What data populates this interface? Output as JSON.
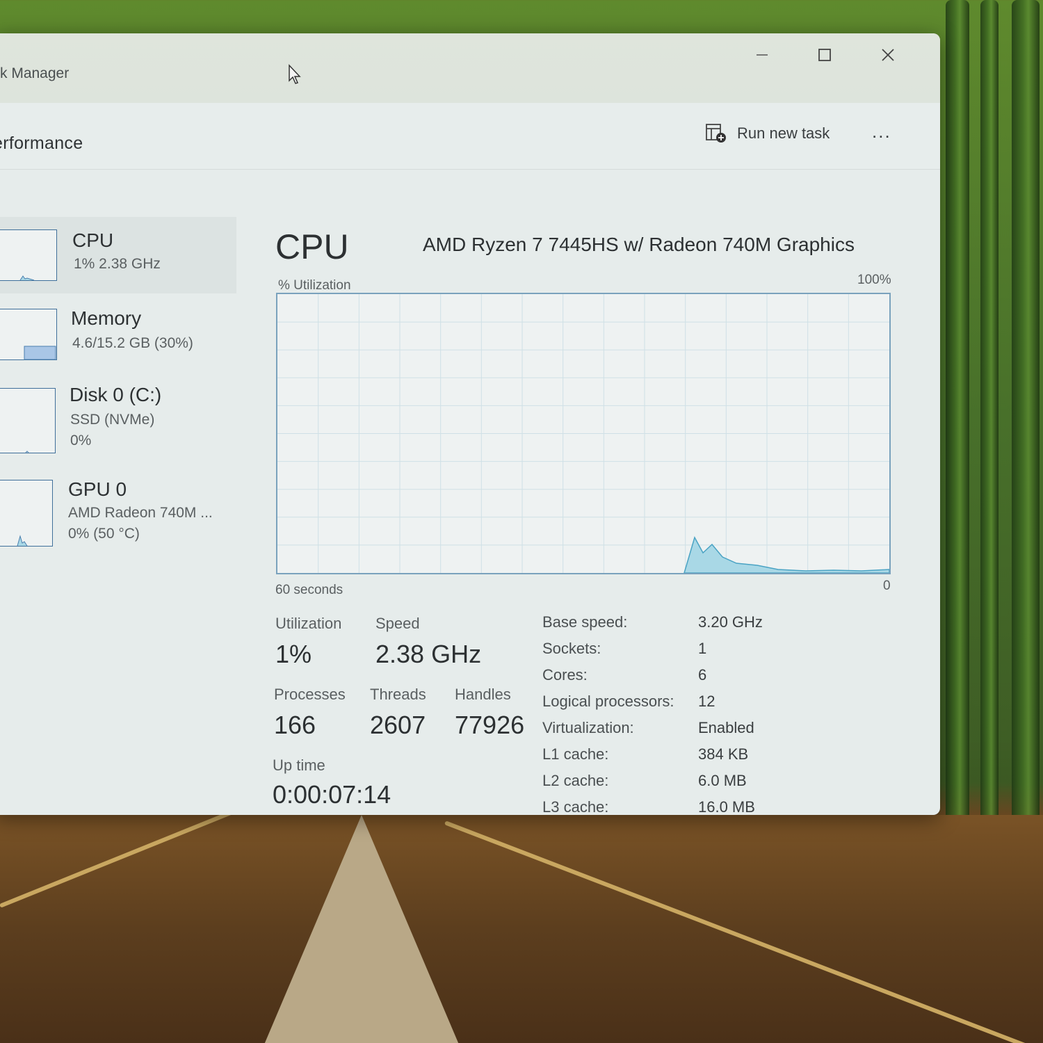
{
  "window": {
    "title": "k Manager",
    "minimize_icon": "minimize-icon",
    "maximize_icon": "maximize-icon",
    "close_icon": "close-icon"
  },
  "toolbar": {
    "section_title": "erformance",
    "run_new_task_label": "Run new task",
    "more_label": "..."
  },
  "sidebar": {
    "items": [
      {
        "name": "CPU",
        "sub1": "1%  2.38 GHz",
        "sub2": ""
      },
      {
        "name": "Memory",
        "sub1": "4.6/15.2 GB (30%)",
        "sub2": ""
      },
      {
        "name": "Disk 0 (C:)",
        "sub1": "SSD (NVMe)",
        "sub2": "0%"
      },
      {
        "name": "GPU 0",
        "sub1": "AMD Radeon 740M ...",
        "sub2": "0%  (50 °C)"
      }
    ]
  },
  "main": {
    "title": "CPU",
    "model": "AMD Ryzen 7 7445HS w/ Radeon 740M Graphics",
    "y_label": "% Utilization",
    "y_max": "100%",
    "x_left": "60 seconds",
    "x_right": "0",
    "stats": {
      "utilization_label": "Utilization",
      "utilization_value": "1%",
      "speed_label": "Speed",
      "speed_value": "2.38 GHz",
      "processes_label": "Processes",
      "processes_value": "166",
      "threads_label": "Threads",
      "threads_value": "2607",
      "handles_label": "Handles",
      "handles_value": "77926",
      "uptime_label": "Up time",
      "uptime_value": "0:00:07:14"
    },
    "specs": [
      {
        "label": "Base speed:",
        "value": "3.20 GHz"
      },
      {
        "label": "Sockets:",
        "value": "1"
      },
      {
        "label": "Cores:",
        "value": "6"
      },
      {
        "label": "Logical processors:",
        "value": "12"
      },
      {
        "label": "Virtualization:",
        "value": "Enabled"
      },
      {
        "label": "L1 cache:",
        "value": "384 KB"
      },
      {
        "label": "L2 cache:",
        "value": "6.0 MB"
      },
      {
        "label": "L3 cache:",
        "value": "16.0 MB"
      }
    ]
  },
  "colors": {
    "graph_line": "#4aa3c4",
    "graph_fill": "#a9d8e6",
    "graph_grid": "#cfe0e6"
  }
}
